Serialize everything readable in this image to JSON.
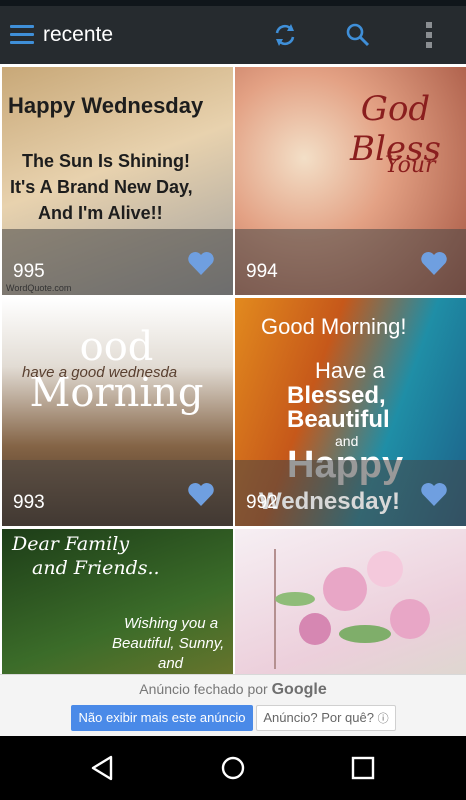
{
  "appbar": {
    "title": "recente",
    "icons": [
      "menu-icon",
      "refresh-icon",
      "search-icon",
      "more-vert-icon"
    ],
    "accent": "#3f8fd8"
  },
  "tiles": [
    {
      "count": "995",
      "lines": [
        "Happy Wednesday",
        "The Sun Is Shining!",
        "It's A Brand New Day,",
        "And I'm Alive!!"
      ],
      "credit": "WordQuote.com"
    },
    {
      "count": "994",
      "lines": [
        "God Bless",
        "Your"
      ]
    },
    {
      "count": "993",
      "lines": [
        "ood Morning",
        "have a good wednesda"
      ]
    },
    {
      "count": "992",
      "lines": [
        "Good Morning!",
        "Have a",
        "Blessed,",
        "Beautiful",
        "and",
        "Happy",
        "Wednesday!"
      ]
    },
    {
      "count": "",
      "lines": [
        "Dear Family",
        "and Friends..",
        "Wishing you a",
        "Beautiful, Sunny,",
        "and"
      ]
    },
    {
      "count": "",
      "lines": []
    }
  ],
  "ad": {
    "closed_text": "Anúncio fechado por",
    "brand": "Google",
    "primary_button": "Não exibir mais este anúncio",
    "secondary_button": "Anúncio? Por quê?",
    "secondary_icon": "ⓘ"
  },
  "navbar": {
    "icons": [
      "back-icon",
      "home-icon",
      "recents-icon"
    ]
  }
}
